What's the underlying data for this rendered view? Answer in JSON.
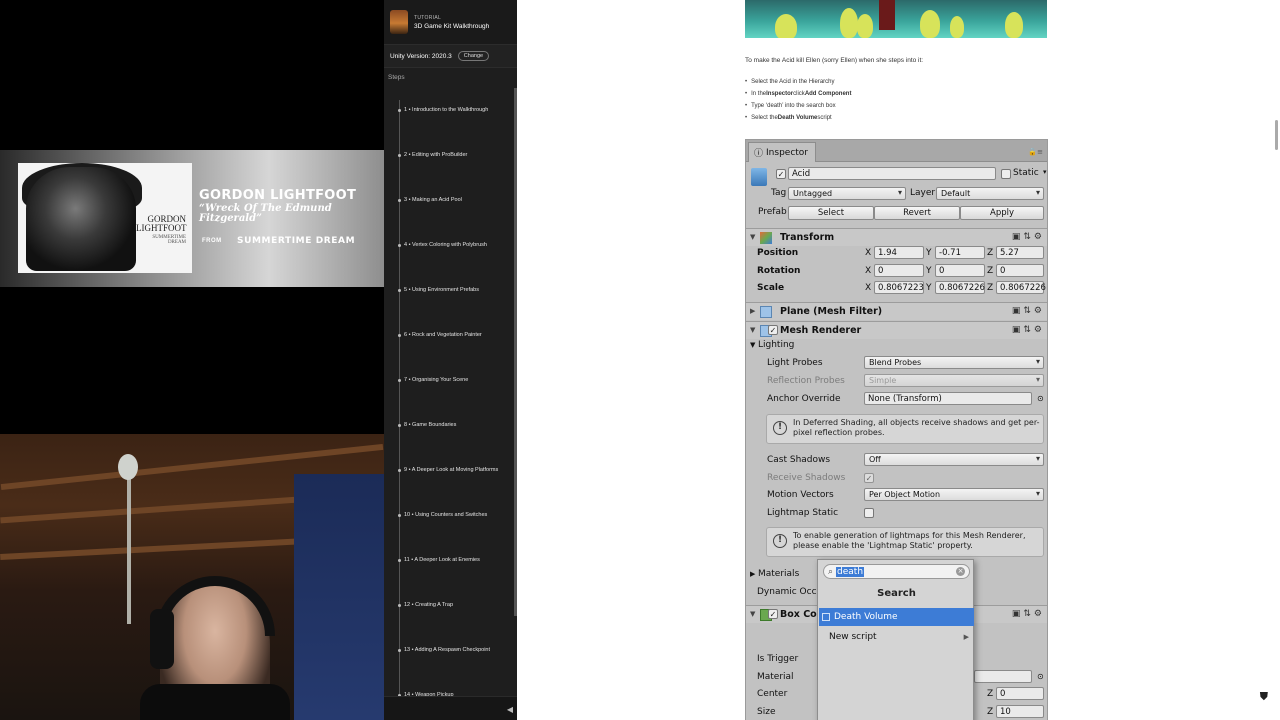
{
  "overlay": {
    "artist": "GORDON LIGHTFOOT",
    "song": "“Wreck Of The Edmund Fitzgerald”",
    "from_label": "FROM",
    "album": "SUMMERTIME DREAM",
    "cover_title": "GORDON LIGHTFOOT",
    "cover_subtitle": "SUMMERTIME DREAM"
  },
  "sidebar": {
    "category": "TUTORIAL",
    "title": "3D Game Kit Walkthrough",
    "unity_version": "Unity Version: 2020.3",
    "change_label": "Change",
    "steps_heading": "Steps",
    "steps": [
      "1 • Introduction to the Walkthrough",
      "2 • Editing with ProBuilder",
      "3 • Making an Acid Pool",
      "4 • Vertex Coloring with Polybrush",
      "5 • Using Environment Prefabs",
      "6 • Rock and Vegetation Painter",
      "7 • Organising Your Scene",
      "8 • Game Boundaries",
      "9 • A Deeper Look at Moving Platforms",
      "10 • Using Counters and Switches",
      "11 • A Deeper Look at Enemies",
      "12 • Creating A Trap",
      "13 • Adding A Respawn Checkpoint",
      "14 • Weapon Pickup"
    ]
  },
  "article": {
    "intro": "To make the Acid kill Ellen (sorry Ellen) when she steps into it:",
    "list": [
      {
        "pre": "Select the Acid in the Hierarchy",
        "bold": "",
        "post": ""
      },
      {
        "pre": "In the ",
        "bold": "Inspector",
        "post": " click ",
        "bold2": "Add Component"
      },
      {
        "pre": "Type ‘death’ into the search box",
        "bold": "",
        "post": ""
      },
      {
        "pre": "Select the ",
        "bold": "Death Volume",
        "post": " script"
      }
    ]
  },
  "inspector": {
    "tab": "Inspector",
    "object_name": "Acid",
    "static_label": "Static",
    "tag_label": "Tag",
    "tag_value": "Untagged",
    "layer_label": "Layer",
    "layer_value": "Default",
    "prefab_label": "Prefab",
    "prefab_buttons": [
      "Select",
      "Revert",
      "Apply"
    ],
    "transform": {
      "title": "Transform",
      "position_label": "Position",
      "rotation_label": "Rotation",
      "scale_label": "Scale",
      "axis": [
        "X",
        "Y",
        "Z"
      ],
      "position": [
        "1.94",
        "-0.71",
        "5.27"
      ],
      "rotation": [
        "0",
        "0",
        "0"
      ],
      "scale": [
        "0.8067223",
        "0.8067226",
        "0.8067226"
      ]
    },
    "mesh_filter": "Plane (Mesh Filter)",
    "mesh_renderer": {
      "title": "Mesh Renderer",
      "lighting_label": "Lighting",
      "light_probes_label": "Light Probes",
      "light_probes_value": "Blend Probes",
      "reflection_probes_label": "Reflection Probes",
      "reflection_probes_value": "Simple",
      "anchor_label": "Anchor Override",
      "anchor_value": "None (Transform)",
      "help_deferred": "In Deferred Shading, all objects receive shadows and get per-pixel reflection probes.",
      "cast_shadows_label": "Cast Shadows",
      "cast_shadows_value": "Off",
      "receive_shadows_label": "Receive Shadows",
      "motion_vectors_label": "Motion Vectors",
      "motion_vectors_value": "Per Object Motion",
      "lightmap_static_label": "Lightmap Static",
      "help_lightmap": "To enable generation of lightmaps for this Mesh Renderer, please enable the 'Lightmap Static' property.",
      "materials_label": "Materials",
      "dynamic_label": "Dynamic Occlu"
    },
    "box_collider": {
      "title": "Box Coll",
      "is_trigger_label": "Is Trigger",
      "material_label": "Material",
      "center_label": "Center",
      "size_label": "Size",
      "center_z": "0",
      "size_z": "10",
      "z": "Z"
    }
  },
  "popup": {
    "search_value": "death",
    "title": "Search",
    "items": [
      "Death Volume",
      "New script"
    ]
  }
}
